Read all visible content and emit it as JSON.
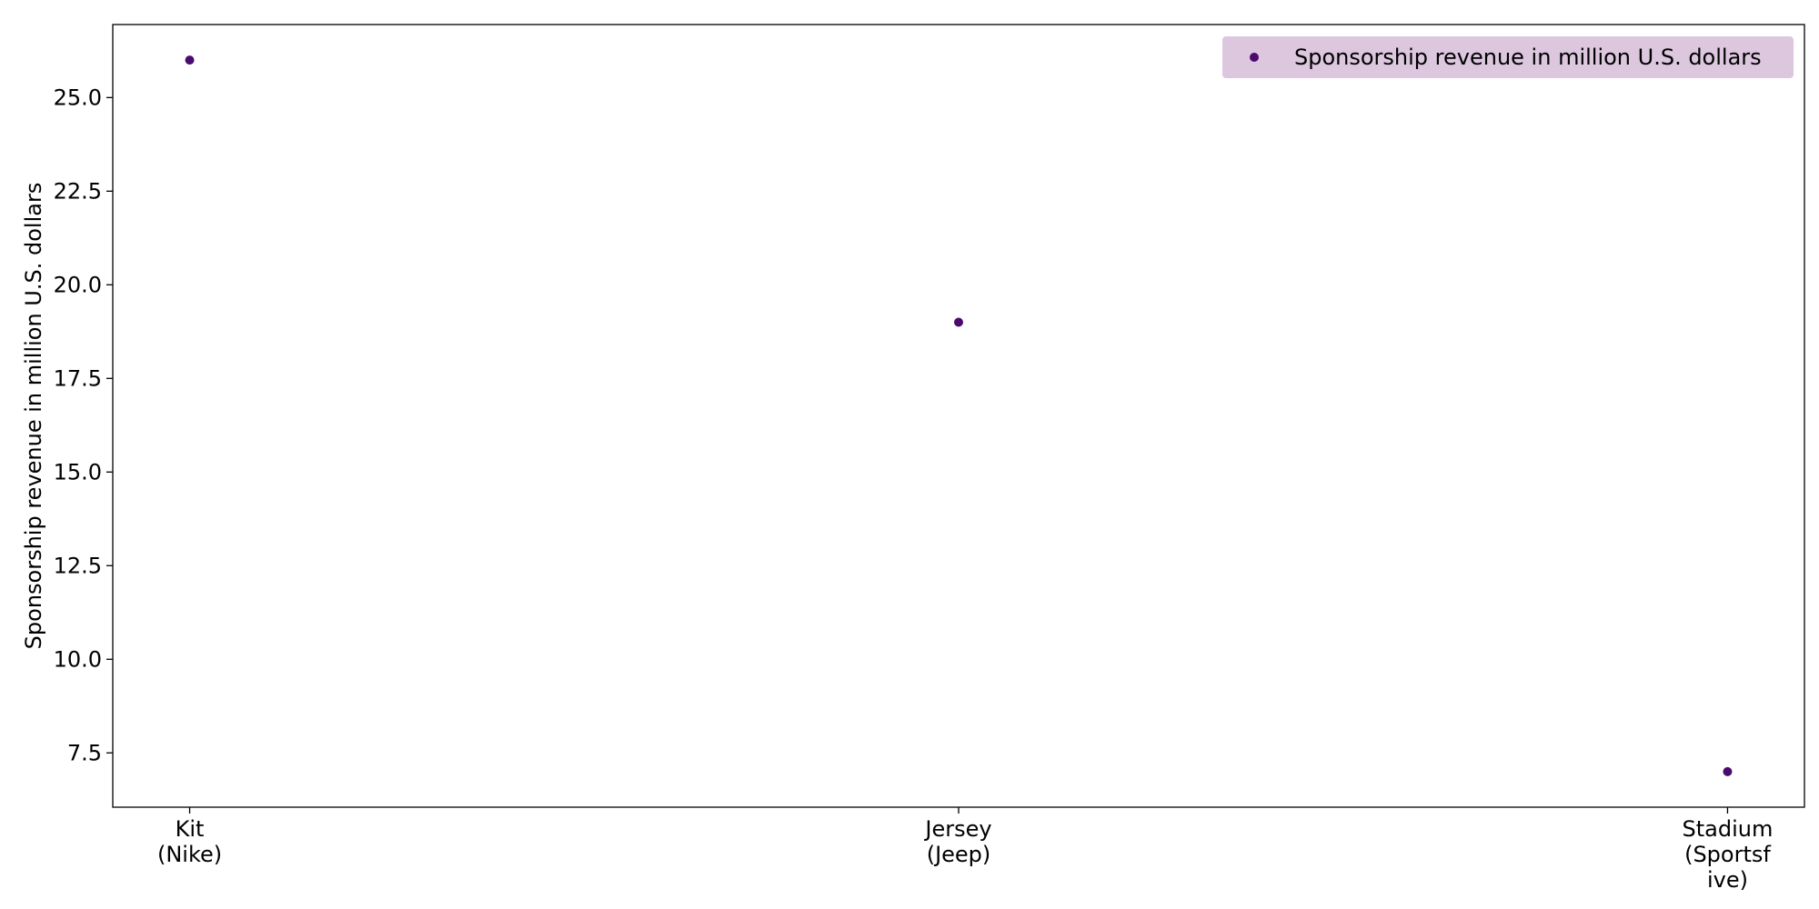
{
  "chart_data": {
    "type": "scatter",
    "categories": [
      "Kit\n(Nike)",
      "Jersey\n(Jeep)",
      "Stadium\n(Sportsf\nive)"
    ],
    "series": [
      {
        "name": "Sponsorship revenue in million U.S. dollars",
        "values": [
          26,
          19,
          7
        ],
        "color": "#4b0a6e"
      }
    ],
    "title": "",
    "xlabel": "",
    "ylabel": "Sponsorship revenue in million U.S. dollars",
    "ylim": [
      6.05,
      26.95
    ],
    "yticks": [
      7.5,
      10.0,
      12.5,
      15.0,
      17.5,
      20.0,
      22.5,
      25.0
    ],
    "ytick_labels": [
      "7.5",
      "10.0",
      "12.5",
      "15.0",
      "17.5",
      "20.0",
      "22.5",
      "25.0"
    ],
    "grid": false,
    "legend": {
      "position": "top-right",
      "background": "#dcc7df"
    }
  }
}
